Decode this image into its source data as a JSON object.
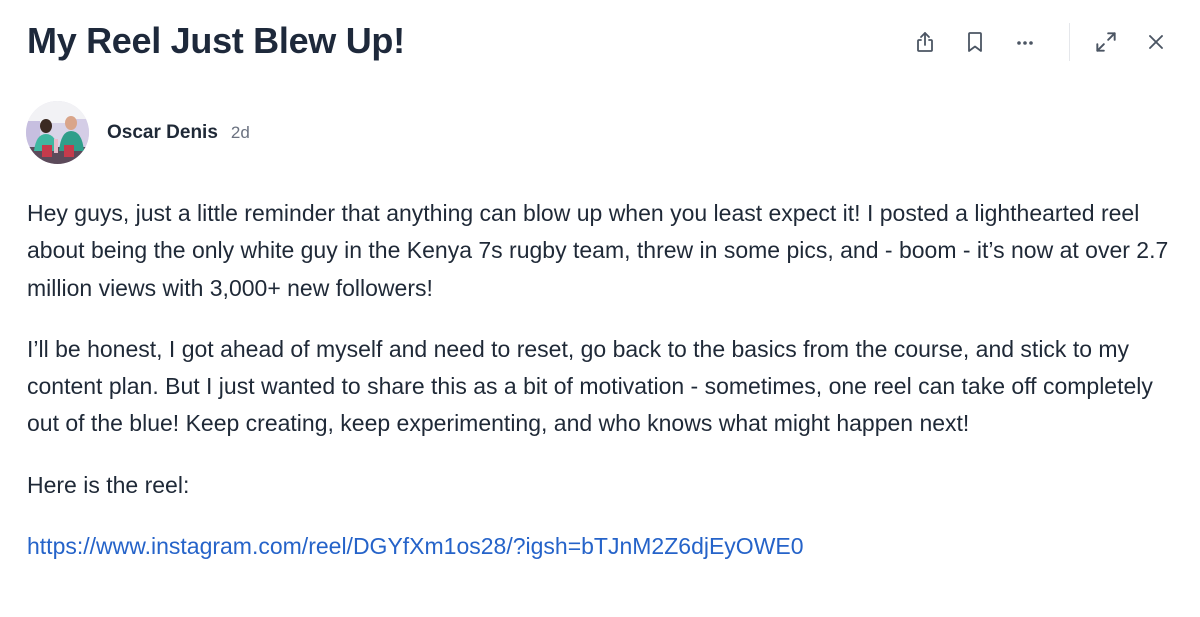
{
  "post": {
    "title": "My Reel Just Blew Up!",
    "author": {
      "name": "Oscar Denis",
      "time": "2d"
    },
    "body": {
      "paragraph_1": "Hey guys, just a little reminder that anything can blow up when you least expect it! I posted a lighthearted reel about being the only white guy in the Kenya 7s rugby team, threw in some pics, and - boom - it’s now at over 2.7 million views with 3,000+ new followers!",
      "paragraph_2": "I’ll be honest, I got ahead of myself and need to reset, go back to the basics from the course, and stick to my content plan. But I just wanted to share this as a bit of motivation - sometimes, one reel can take off completely out of the blue! Keep creating, keep experimenting, and who knows what might happen next!",
      "paragraph_3": "Here is the reel:",
      "link_text": "https://www.instagram.com/reel/DGYfXm1os28/?igsh=bTJnM2Z6djEyOWE0"
    }
  },
  "toolbar": {
    "icons": [
      "share-icon",
      "bookmark-icon",
      "more-icon",
      "expand-icon",
      "close-icon"
    ]
  },
  "colors": {
    "link": "#2563c9",
    "title": "#1e293b",
    "muted": "#6b7280"
  }
}
